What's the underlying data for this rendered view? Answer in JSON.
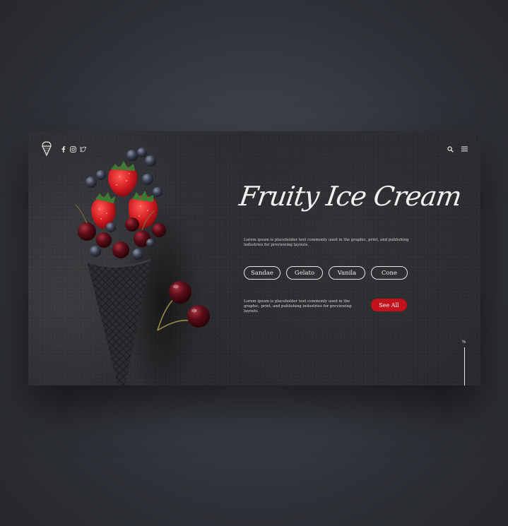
{
  "hero": {
    "title": "Fruity Ice Cream",
    "description": "Lorem ipsum is placeholder text commonly used in the graphic, print, and publishing industries for previewing layouts."
  },
  "tags": [
    "Sandae",
    "Gelato",
    "Vanila",
    "Cone"
  ],
  "cta": {
    "description": "Lorem ipsum is placeholder text commonly used in the graphic, print, and publishing industries for previewing layouts.",
    "button_label": "See All"
  },
  "scroll": {
    "label": "%",
    "progress": 1.0
  },
  "icons": {
    "logo": "ice-cream-logo-icon",
    "social": [
      "facebook-icon",
      "instagram-icon",
      "twitter-icon"
    ],
    "search": "search-icon",
    "menu": "hamburger-menu-icon"
  },
  "colors": {
    "card_bg": "#2a2b2e",
    "accent": "#c2111b",
    "text": "#f0f0f0",
    "page_bg": "#3d4048"
  }
}
